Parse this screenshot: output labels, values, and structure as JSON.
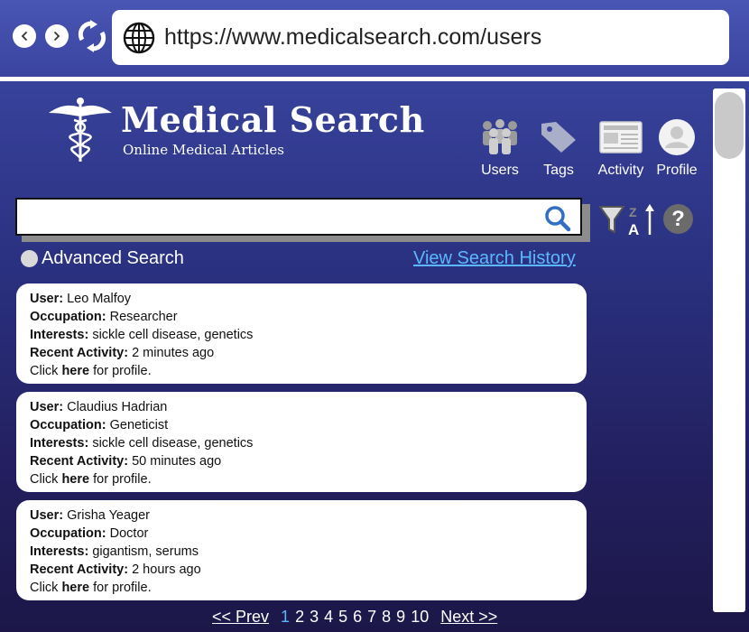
{
  "browser": {
    "url": "https://www.medicalsearch.com/users"
  },
  "header": {
    "title": "Medical Search",
    "subtitle": "Online Medical Articles"
  },
  "topnav": {
    "items": [
      {
        "label": "Users",
        "icon": "users-icon"
      },
      {
        "label": "Tags",
        "icon": "tag-icon"
      },
      {
        "label": "Activity",
        "icon": "activity-icon"
      },
      {
        "label": "Profile",
        "icon": "profile-icon"
      }
    ]
  },
  "search": {
    "value": "",
    "advanced_label": "Advanced Search",
    "history_link": "View Search History"
  },
  "labels": {
    "user": "User:",
    "occupation": "Occupation:",
    "interests": "Interests:",
    "recent_activity": "Recent Activity:",
    "click": "Click",
    "here": "here",
    "for_profile": "for profile."
  },
  "results": [
    {
      "user": "Leo Malfoy",
      "occupation": "Researcher",
      "interests": "sickle cell disease, genetics",
      "recent_activity": "2 minutes ago"
    },
    {
      "user": "Claudius Hadrian",
      "occupation": "Geneticist",
      "interests": "sickle cell disease, genetics",
      "recent_activity": "50 minutes ago"
    },
    {
      "user": "Grisha Yeager",
      "occupation": "Doctor",
      "interests": "gigantism, serums",
      "recent_activity": "2 hours ago"
    }
  ],
  "pagination": {
    "prev": "<< Prev",
    "next": "Next >>",
    "pages": [
      "1",
      "2",
      "3",
      "4",
      "5",
      "6",
      "7",
      "8",
      "9",
      "10"
    ],
    "current": "1"
  },
  "colors": {
    "link": "#5bb8ff",
    "background_top": "#3d4aa6",
    "background_bottom": "#1c1748"
  }
}
